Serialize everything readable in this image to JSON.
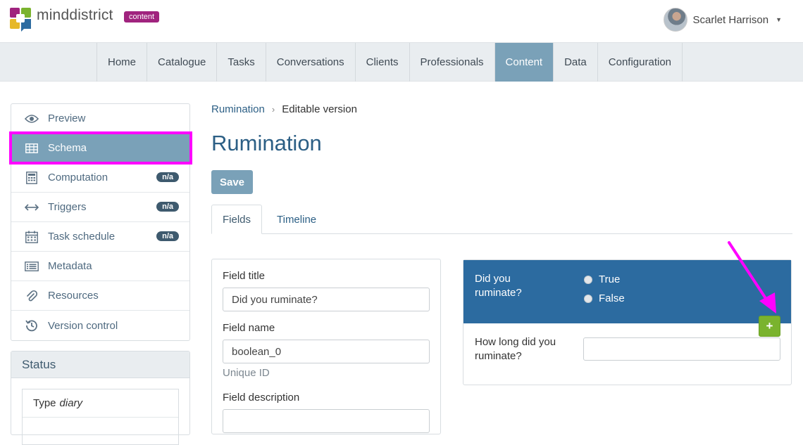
{
  "brand": {
    "name": "minddistrict",
    "badge": "content"
  },
  "user": {
    "name": "Scarlet Harrison"
  },
  "nav": [
    {
      "label": "Home"
    },
    {
      "label": "Catalogue"
    },
    {
      "label": "Tasks"
    },
    {
      "label": "Conversations"
    },
    {
      "label": "Clients"
    },
    {
      "label": "Professionals"
    },
    {
      "label": "Content",
      "active": true
    },
    {
      "label": "Data"
    },
    {
      "label": "Configuration"
    }
  ],
  "sidebar": {
    "items": [
      {
        "label": "Preview",
        "icon": "eye-icon"
      },
      {
        "label": "Schema",
        "icon": "table-icon",
        "active": true
      },
      {
        "label": "Computation",
        "icon": "calculator-icon",
        "badge": "n/a"
      },
      {
        "label": "Triggers",
        "icon": "arrows-horizontal-icon",
        "badge": "n/a"
      },
      {
        "label": "Task schedule",
        "icon": "calendar-icon",
        "badge": "n/a"
      },
      {
        "label": "Metadata",
        "icon": "list-icon"
      },
      {
        "label": "Resources",
        "icon": "paperclip-icon"
      },
      {
        "label": "Version control",
        "icon": "history-icon"
      }
    ]
  },
  "status": {
    "heading": "Status",
    "type_label": "Type",
    "type_value": "diary"
  },
  "breadcrumb": {
    "parent": "Rumination",
    "current": "Editable version"
  },
  "page": {
    "title": "Rumination",
    "save_label": "Save"
  },
  "tabs": [
    {
      "label": "Fields",
      "active": true
    },
    {
      "label": "Timeline"
    }
  ],
  "field_editor": {
    "title_label": "Field title",
    "title_value": "Did you ruminate?",
    "name_label": "Field name",
    "name_value": "boolean_0",
    "name_help": "Unique ID",
    "description_label": "Field description",
    "description_value": ""
  },
  "preview": {
    "question": "Did you ruminate?",
    "options": [
      "True",
      "False"
    ],
    "question2": "How long did you ruminate?",
    "add_label": "+"
  },
  "colors": {
    "accent": "#7aa1b8",
    "highlight": "#ff00ff",
    "preview_bg": "#2c6ba0",
    "add_button": "#7ab32e",
    "badge": "#a0237e"
  }
}
